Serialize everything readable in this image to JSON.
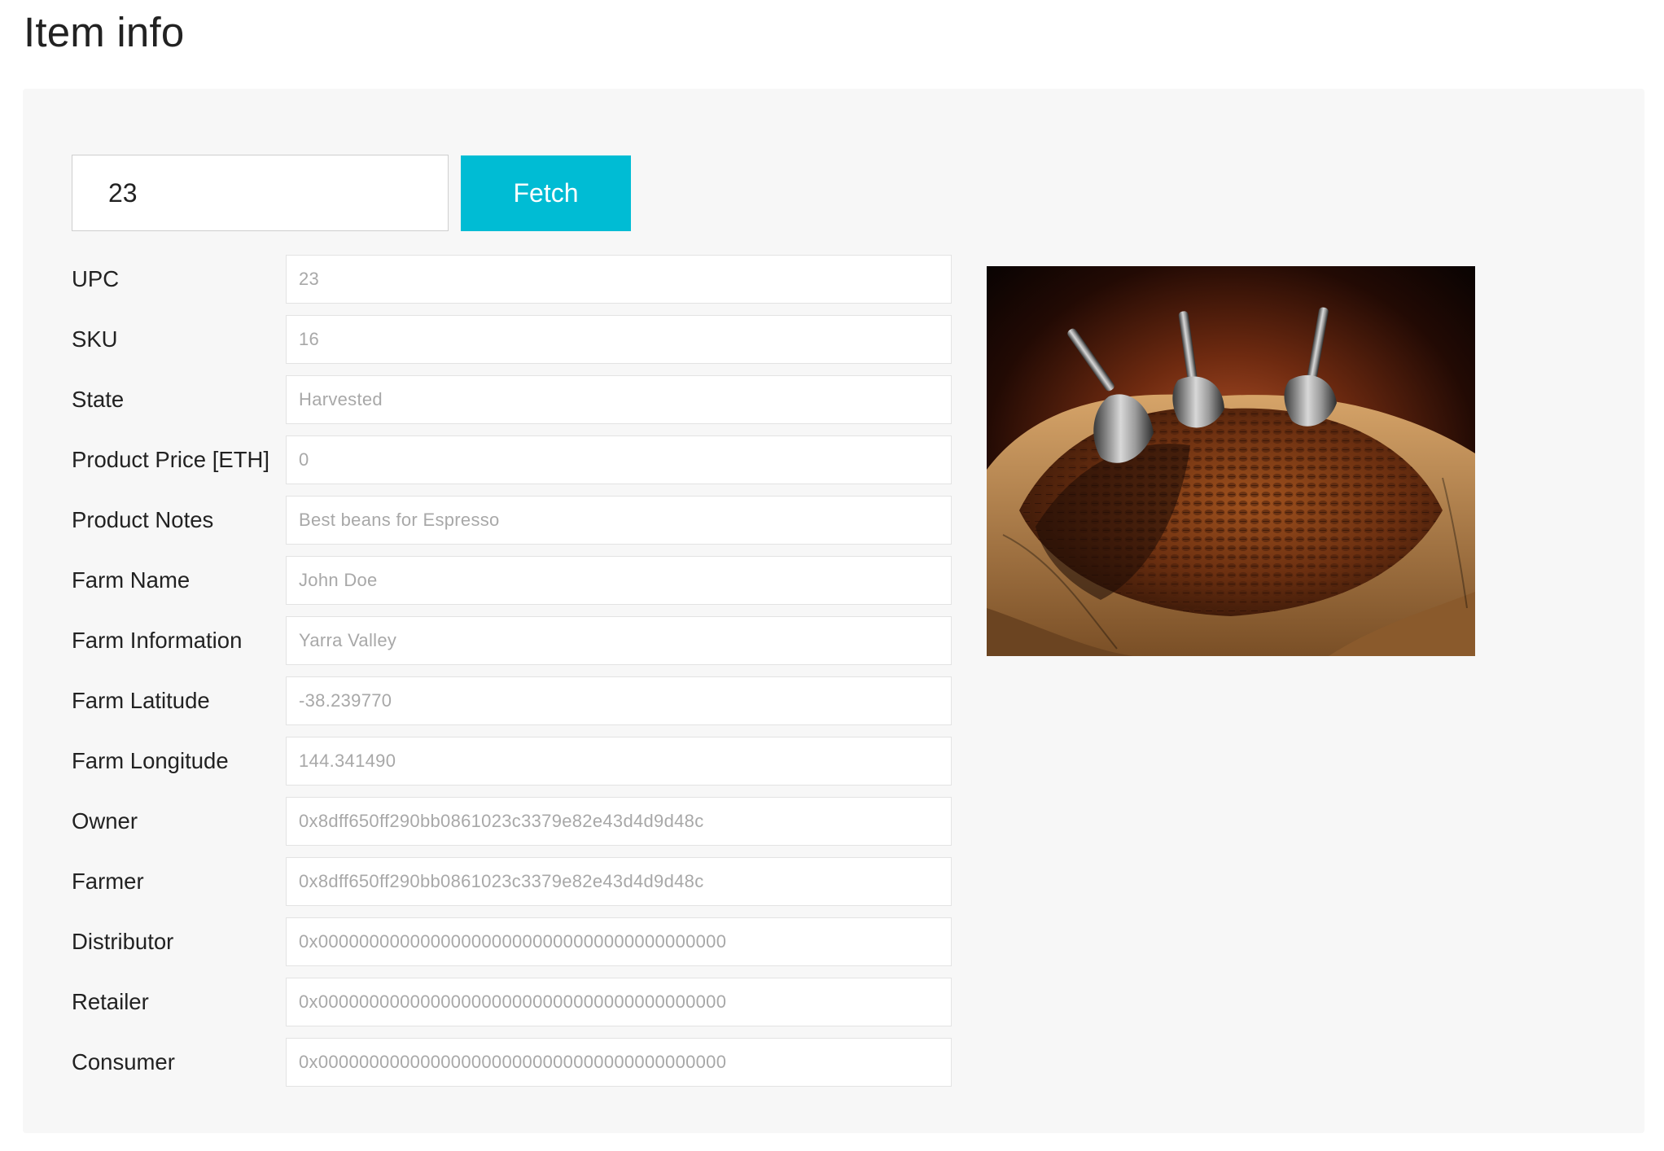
{
  "page": {
    "title": "Item info"
  },
  "fetch": {
    "input_value": "23",
    "button_label": "Fetch"
  },
  "fields": [
    {
      "label": "UPC",
      "value": "23"
    },
    {
      "label": "SKU",
      "value": "16"
    },
    {
      "label": "State",
      "value": "Harvested"
    },
    {
      "label": "Product Price [ETH]",
      "value": "0"
    },
    {
      "label": "Product Notes",
      "value": "Best beans for Espresso"
    },
    {
      "label": "Farm Name",
      "value": "John Doe"
    },
    {
      "label": "Farm Information",
      "value": "Yarra Valley"
    },
    {
      "label": "Farm Latitude",
      "value": "-38.239770"
    },
    {
      "label": "Farm Longitude",
      "value": "144.341490"
    },
    {
      "label": "Owner",
      "value": "0x8dff650ff290bb0861023c3379e82e43d4d9d48c"
    },
    {
      "label": "Farmer",
      "value": "0x8dff650ff290bb0861023c3379e82e43d4d9d48c"
    },
    {
      "label": "Distributor",
      "value": "0x0000000000000000000000000000000000000000"
    },
    {
      "label": "Retailer",
      "value": "0x0000000000000000000000000000000000000000"
    },
    {
      "label": "Consumer",
      "value": "0x0000000000000000000000000000000000000000"
    }
  ],
  "image": {
    "subject": "coffee-beans-sack-with-scoops"
  },
  "colors": {
    "accent": "#00bcd4",
    "panel_background": "#f7f7f7",
    "value_text": "#a8a8a8"
  }
}
